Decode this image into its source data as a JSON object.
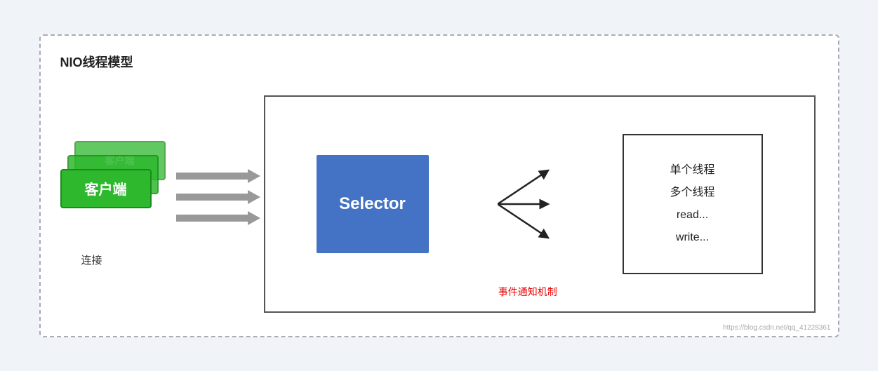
{
  "diagram": {
    "title": "NIO线程模型",
    "clients": {
      "back2_label": "客户端",
      "back1_label": "客户端",
      "front_label": "客户端"
    },
    "connect_label": "连接",
    "selector_label": "Selector",
    "event_label": "事件通知机制",
    "right_info": {
      "line1": "单个线程",
      "line2": "多个线程",
      "line3": "read...",
      "line4": "write..."
    },
    "watermark": "https://blog.csdn.net/qq_41228361"
  }
}
